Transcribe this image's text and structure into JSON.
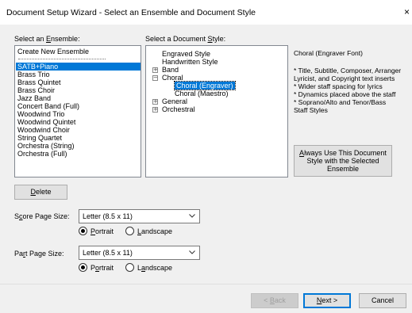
{
  "window": {
    "title": "Document Setup Wizard - Select an Ensemble and Document Style",
    "close_glyph": "×"
  },
  "ensemble": {
    "label_pre": "Select an ",
    "label_key": "E",
    "label_post": "nsemble:",
    "items": [
      "Create New Ensemble",
      "SATB+Piano",
      "Brass Trio",
      "Brass Quintet",
      "Brass Choir",
      "Jazz Band",
      "Concert Band (Full)",
      "Woodwind Trio",
      "Woodwind Quintet",
      "Woodwind Choir",
      "String Quartet",
      "Orchestra (String)",
      "Orchestra (Full)"
    ],
    "selected": "SATB+Piano"
  },
  "style": {
    "label_pre": "Select a Document ",
    "label_key": "S",
    "label_post": "tyle:",
    "tree": [
      {
        "label": "Engraved Style",
        "expander": ""
      },
      {
        "label": "Handwritten Style",
        "expander": ""
      },
      {
        "label": "Band",
        "expander": "+"
      },
      {
        "label": "Choral",
        "expander": "−"
      },
      {
        "label": "Choral (Engraver)",
        "expander": ""
      },
      {
        "label": "Choral (Maestro)",
        "expander": ""
      },
      {
        "label": "General",
        "expander": "+"
      },
      {
        "label": "Orchestral",
        "expander": "+"
      }
    ],
    "selected": "Choral (Engraver)"
  },
  "description": {
    "title": "Choral (Engraver Font)",
    "lines": [
      "* Title, Subtitle, Composer, Arranger",
      "Lyricist, and Copyright text inserts",
      "* Wider staff spacing for lyrics",
      "* Dynamics placed above the staff",
      "* Soprano/Alto and Tenor/Bass",
      "Staff Styles"
    ]
  },
  "always_use_button": {
    "line1_key": "A",
    "line1_rest": "lways Use This Document",
    "line2": "Style with the Selected",
    "line3": "Ensemble"
  },
  "delete_button": {
    "key": "D",
    "rest": "elete"
  },
  "score_page": {
    "label_pre": "S",
    "label_key": "c",
    "label_post": "ore Page Size:",
    "value": "Letter (8.5 x 11)",
    "orientation": {
      "portrait_key": "P",
      "portrait_rest": "ortrait",
      "landscape_key": "L",
      "landscape_rest": "andscape",
      "selected": "portrait"
    }
  },
  "part_page": {
    "label_pre": "Pa",
    "label_key": "r",
    "label_post": "t Page Size:",
    "value": "Letter (8.5 x 11)",
    "orientation": {
      "portrait_pre": "P",
      "portrait_key": "o",
      "portrait_rest": "rtrait",
      "landscape_pre": "L",
      "landscape_key": "a",
      "landscape_rest": "ndscape",
      "selected": "portrait"
    }
  },
  "footer": {
    "back": {
      "pre": "< ",
      "key": "B",
      "rest": "ack",
      "enabled": false
    },
    "next": {
      "key": "N",
      "rest": "ext >"
    },
    "cancel": "Cancel"
  },
  "colors": {
    "selection": "#0078d7",
    "dialog_bg": "#f0f0f0",
    "primary_border": "#0078d7"
  }
}
